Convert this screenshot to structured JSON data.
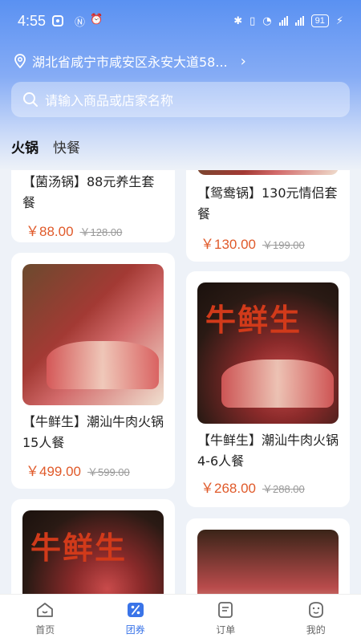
{
  "status": {
    "time": "4:55",
    "battery": "91"
  },
  "location": {
    "address": "湖北省咸宁市咸安区永安大道58..."
  },
  "search": {
    "placeholder": "请输入商品或店家名称"
  },
  "tabs": [
    {
      "label": "火锅",
      "active": true
    },
    {
      "label": "快餐",
      "active": false
    }
  ],
  "products": [
    {
      "title": "【菌汤锅】88元养生套餐",
      "price": "￥88.00",
      "old_price": "￥128.00"
    },
    {
      "title": "【鸳鸯锅】130元情侣套餐",
      "price": "￥130.00",
      "old_price": "￥199.00"
    },
    {
      "title": "【牛鲜生】潮汕牛肉火锅15人餐",
      "price": "￥499.00",
      "old_price": "￥599.00"
    },
    {
      "title": "【牛鲜生】潮汕牛肉火锅4-6人餐",
      "price": "￥268.00",
      "old_price": "￥288.00"
    }
  ],
  "image_text": {
    "brand": "牛鲜生"
  },
  "bottom_nav": [
    {
      "label": "首页",
      "icon": "home-icon",
      "active": false
    },
    {
      "label": "团券",
      "icon": "coupon-icon",
      "active": true
    },
    {
      "label": "订单",
      "icon": "order-icon",
      "active": false
    },
    {
      "label": "我的",
      "icon": "profile-icon",
      "active": false
    }
  ],
  "colors": {
    "accent": "#3a74e8",
    "price": "#e05a2a",
    "header": "#5a91f2"
  }
}
